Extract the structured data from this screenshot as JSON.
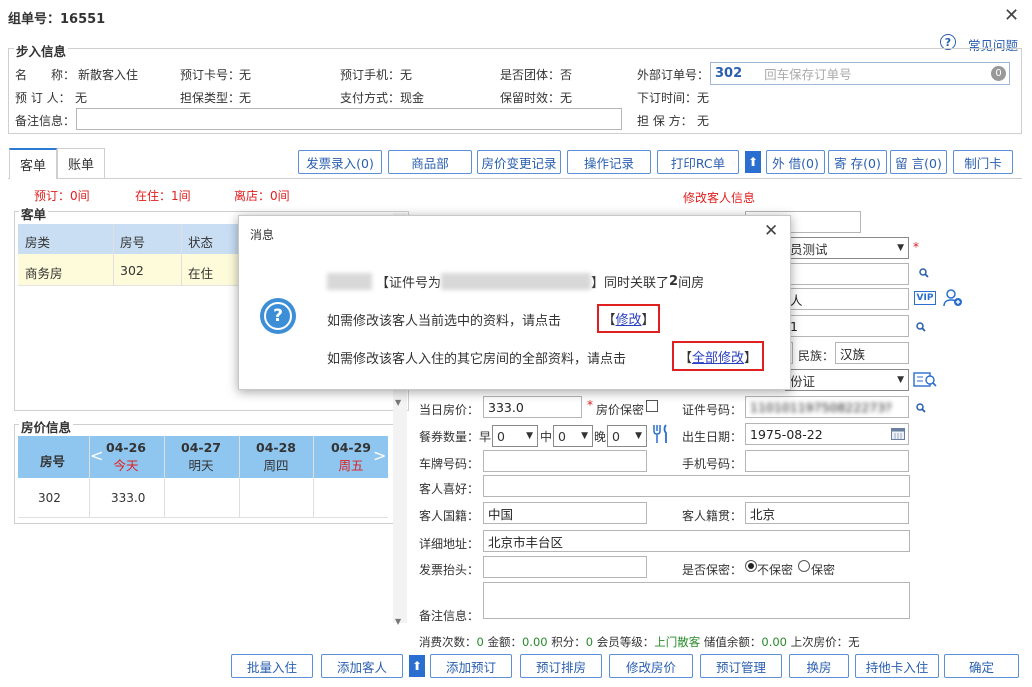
{
  "window": {
    "title": "组单号：16551"
  },
  "help": {
    "label": "常见问题"
  },
  "step_in": {
    "section": "步入信息",
    "name_label": "名　　称：",
    "name_value": "新散客入住",
    "card_label": "预订卡号：",
    "card_value": "无",
    "phone_label": "预订手机：",
    "phone_value": "无",
    "group_label": "是否团体：",
    "group_value": "否",
    "ext_order_label": "外部订单号：",
    "ext_order_value": "302",
    "ext_order_placeholder": "回车保存订单号",
    "ext_order_badge": "0",
    "booker_label": "预 订 人：",
    "booker_value": "无",
    "guarantee_type_label": "担保类型：",
    "guarantee_type_value": "无",
    "pay_label": "支付方式：",
    "pay_value": "现金",
    "retain_label": "保留时效：",
    "retain_value": "无",
    "order_time_label": "下订时间：",
    "order_time_value": "无",
    "remark_label": "备注信息：",
    "guarantor_label": "担 保 方：",
    "guarantor_value": "无"
  },
  "tabs": [
    "客单",
    "账单"
  ],
  "toolbar": [
    "发票录入(0)",
    "商品部",
    "房价变更记录",
    "操作记录",
    "打印RC单",
    "外 借(0)",
    "寄 存(0)",
    "留 言(0)",
    "制门卡"
  ],
  "counts": {
    "reserve": "预订：0间",
    "in": "在住：1间",
    "left": "离店：0间"
  },
  "guest_list": {
    "section": "客单",
    "headers": [
      "房类",
      "房号",
      "状态"
    ],
    "rows": [
      [
        "商务房",
        "302",
        "在住"
      ]
    ]
  },
  "price_info": {
    "section": "房价信息",
    "room_header": "房号",
    "days": [
      {
        "date": "04-26",
        "label": "今天",
        "red": true
      },
      {
        "date": "04-27",
        "label": "明天",
        "red": false
      },
      {
        "date": "04-28",
        "label": "周四",
        "red": false
      },
      {
        "date": "04-29",
        "label": "周五",
        "red": true
      }
    ],
    "rows": [
      {
        "room": "302",
        "prices": [
          "333.0",
          "",
          "",
          ""
        ]
      }
    ]
  },
  "edit_guest": {
    "title": "修改客人信息",
    "member_value": "员测试",
    "vip_text": "VIP",
    "guest_name_value": "人",
    "phone_partial": "1",
    "ethnic_label": "民族：",
    "ethnic_value": "汉族",
    "id_type_value": "份证",
    "today_price_label": "当日房价：",
    "today_price_value": "333.0",
    "price_secret_label": "房价保密",
    "id_no_label": "证件号码：",
    "id_no_value": "11010119750822273?",
    "meal_label": "餐券数量：",
    "breakfast_label": "早",
    "lunch_label": "中",
    "dinner_label": "晚",
    "meal_value": "0",
    "birth_label": "出生日期：",
    "birth_value": "1975-08-22",
    "plate_label": "车牌号码：",
    "mobile_label": "手机号码：",
    "hobby_label": "客人喜好：",
    "nation_label": "客人国籍：",
    "nation_value": "中国",
    "native_label": "客人籍贯：",
    "native_value": "北京",
    "address_label": "详细地址：",
    "address_value": "北京市丰台区",
    "invoice_label": "发票抬头：",
    "secret_label": "是否保密：",
    "secret_opt1": "不保密",
    "secret_opt2": "保密",
    "remark_label": "备注信息："
  },
  "stats": {
    "count_label": "消费次数：",
    "count_value": "0",
    "amount_label": "金额：",
    "amount_value": "0.00",
    "points_label": "积分：",
    "points_value": "0",
    "level_label": "会员等级：",
    "level_value": "上门散客",
    "stored_label": "储值余额：",
    "stored_value": "0.00",
    "last_price_label": "上次房价：",
    "last_price_value": "无"
  },
  "bottom_buttons": [
    "批量入住",
    "添加客人",
    "添加预订",
    "预订排房",
    "修改房价",
    "预订管理",
    "换房",
    "持他卡入住",
    "确定"
  ],
  "dialog": {
    "title": "消息",
    "line1_mid": "【证件号为",
    "line1_end": "】同时关联了",
    "line1_num": "2",
    "line1_tail": "间房",
    "line2": "如需修改该客人当前选中的资料，请点击",
    "line2_link": "修改",
    "line3": "如需修改该客人入住的其它房间的全部资料，请点击",
    "line3_link": "全部修改"
  },
  "colors": {
    "accent": "#2a5fb0",
    "header_bg": "#8fc6ef",
    "highlight": "#fdfbd9",
    "red": "#e02020"
  }
}
